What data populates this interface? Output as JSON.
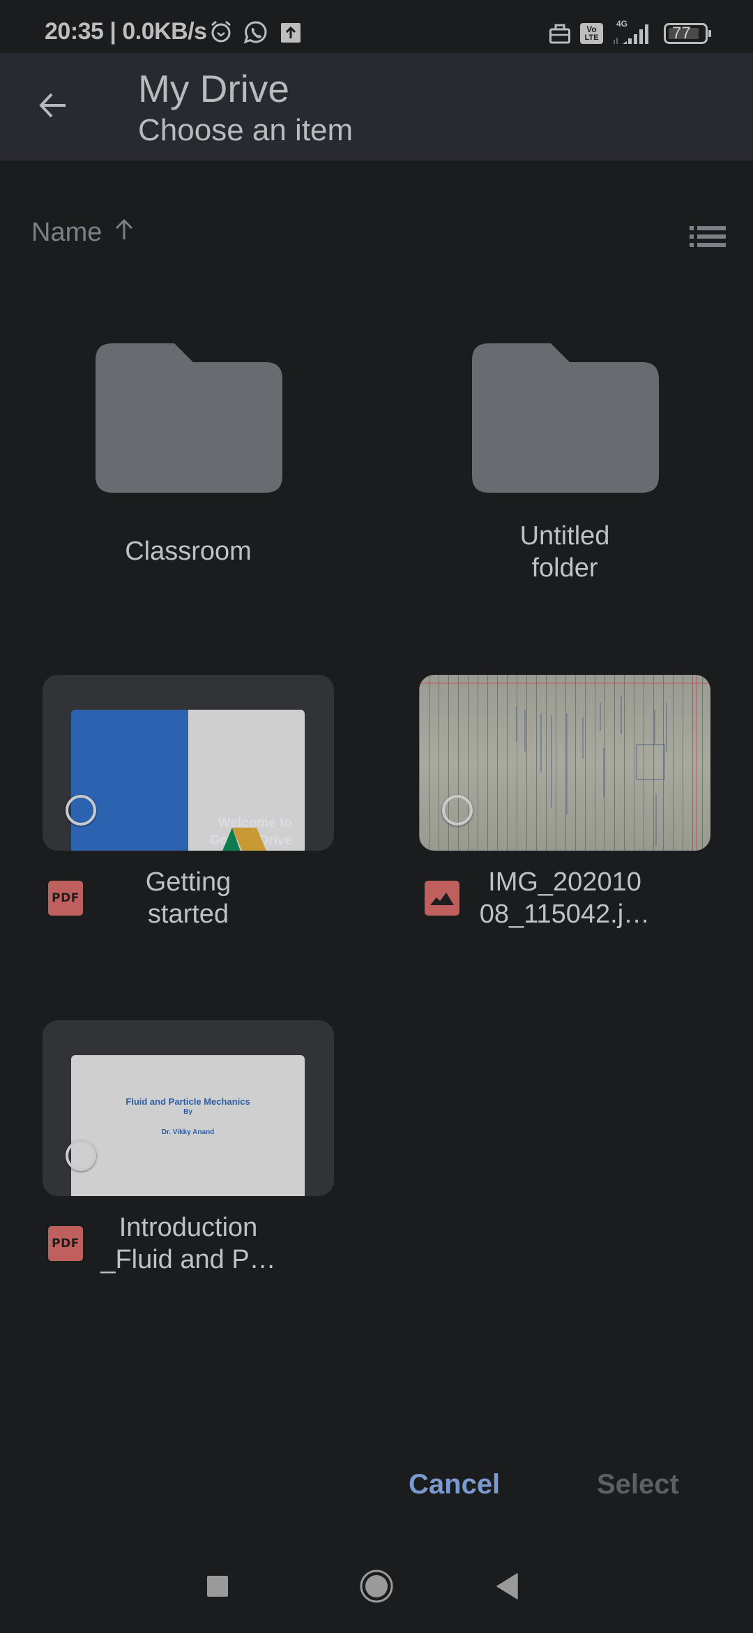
{
  "status_bar": {
    "time_and_speed": "20:35 | 0.0KB/s",
    "left_icons": [
      "alarm-icon",
      "whatsapp-icon",
      "upload-icon"
    ],
    "right_icons": [
      "briefcase-icon",
      "volte-icon",
      "signal-4g-icon",
      "battery-icon"
    ],
    "volte_line1": "Vo",
    "volte_line2": "LTE",
    "network_type": "4G",
    "battery_level": "77"
  },
  "app_bar": {
    "back_icon": "arrow-back-icon",
    "title": "My Drive",
    "subtitle": "Choose an item"
  },
  "sort": {
    "label": "Name",
    "direction_icon": "arrow-up-icon",
    "view_toggle_icon": "list-view-icon"
  },
  "folders": [
    {
      "name": "Classroom"
    },
    {
      "name_line1": "Untitled",
      "name_line2": "folder",
      "name": "Untitled folder"
    }
  ],
  "files": [
    {
      "name_line1": "Getting",
      "name_line2": "started",
      "type": "PDF",
      "type_icon": "pdf-icon",
      "thumb_text_line1": "Welcome to",
      "thumb_text_line2": "Google Drive",
      "selected": false
    },
    {
      "name_line1": "IMG_202010",
      "name_line2": "08_115042.j…",
      "type": "image",
      "type_icon": "image-icon",
      "selected": false
    },
    {
      "name_line1": "Introduction",
      "name_line2": "_Fluid and P…",
      "type": "PDF",
      "type_icon": "pdf-icon",
      "thumb_title": "Fluid and Particle Mechanics",
      "thumb_by": "By",
      "thumb_author": "Dr. Vikky Anand",
      "selected": false
    }
  ],
  "dialog": {
    "cancel_label": "Cancel",
    "select_label": "Select"
  },
  "nav_bar": {
    "recents_icon": "square-recents-icon",
    "home_icon": "circle-home-icon",
    "back_icon": "triangle-back-icon"
  },
  "colors": {
    "background": "#1b1c1e",
    "app_bar": "#292a2f",
    "accent": "#7b9ad0",
    "disabled": "#5d5f62",
    "file_type_icon": "#c0605e",
    "folder": "#686b70"
  }
}
